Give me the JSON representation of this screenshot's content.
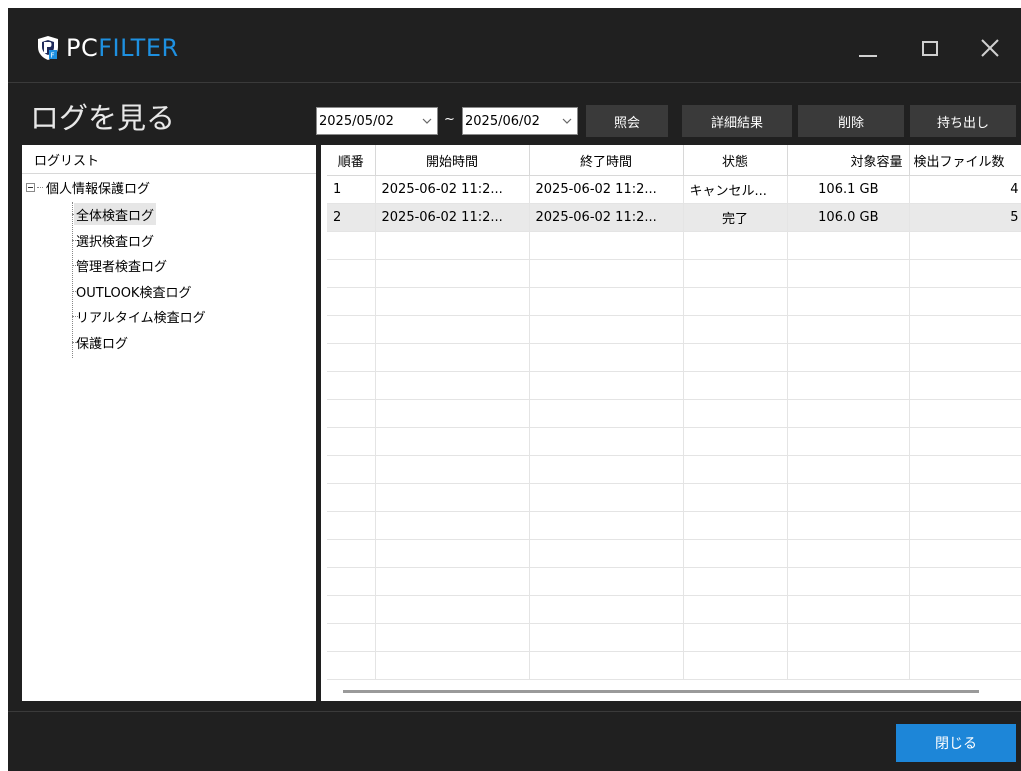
{
  "brand": {
    "pc": "PC",
    "filter": "FILTER",
    "accent": "#1e90e0"
  },
  "window_controls": {
    "minimize_icon": "minimize-icon",
    "maximize_icon": "maximize-icon",
    "close_icon": "close-icon"
  },
  "page_title": "ログを見る",
  "filters": {
    "date_from": "2025/05/02",
    "date_to": "2025/06/02",
    "range_separator": "~"
  },
  "toolbar": {
    "query_label": "照会",
    "details_label": "詳細結果",
    "delete_label": "削除",
    "export_label": "持ち出し"
  },
  "sidebar": {
    "header": "ログリスト",
    "root_label": "個人情報保護ログ",
    "items": [
      {
        "label": "全体検査ログ",
        "selected": true
      },
      {
        "label": "選択検査ログ",
        "selected": false
      },
      {
        "label": "管理者検査ログ",
        "selected": false
      },
      {
        "label": "OUTLOOK検査ログ",
        "selected": false
      },
      {
        "label": "リアルタイム検査ログ",
        "selected": false
      },
      {
        "label": "保護ログ",
        "selected": false
      }
    ]
  },
  "table": {
    "columns": [
      "順番",
      "開始時間",
      "終了時間",
      "状態",
      "対象容量",
      "検出ファイル数"
    ],
    "rows": [
      [
        "1",
        "2025-06-02 11:2...",
        "2025-06-02 11:2...",
        "キャンセル...",
        "106.1 GB",
        "4"
      ],
      [
        "2",
        "2025-06-02 11:2...",
        "2025-06-02 11:2...",
        "完了",
        "106.0 GB",
        "5"
      ]
    ]
  },
  "footer": {
    "close_label": "閉じる",
    "close_color": "#1d86d8"
  }
}
